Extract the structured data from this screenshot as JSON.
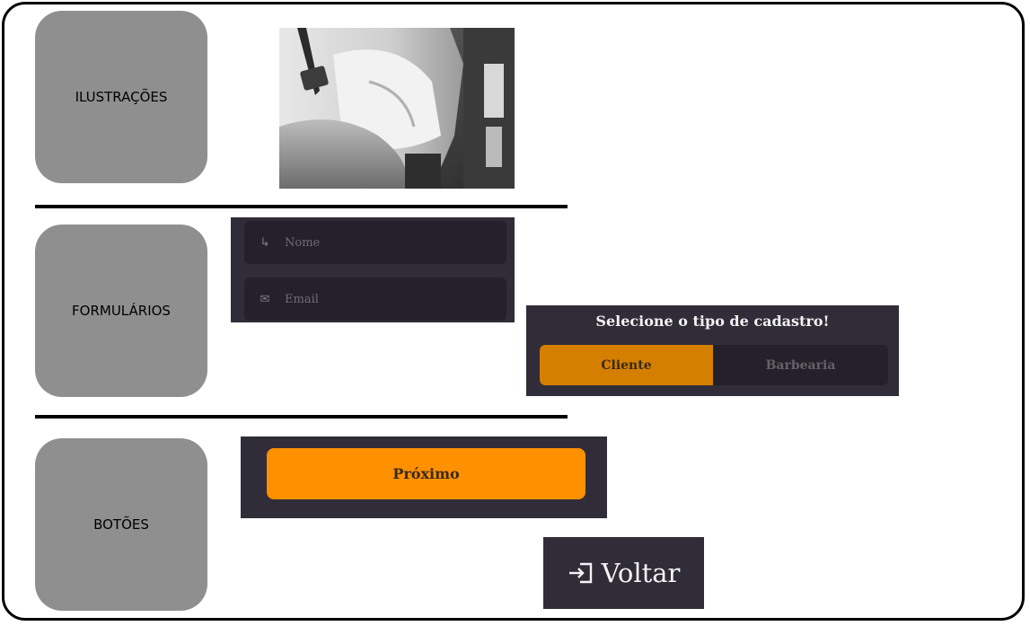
{
  "sections": {
    "illustrations": "ILUSTRAÇÕES",
    "forms": "FORMULÁRIOS",
    "buttons": "BOTÕES"
  },
  "form": {
    "name_placeholder": "Nome",
    "email_placeholder": "Email",
    "name_icon": "arrow-corner-icon",
    "email_icon": "envelope-icon"
  },
  "signup_type": {
    "title": "Selecione o tipo de cadastro!",
    "options": [
      "Cliente",
      "Barbearia"
    ],
    "selected": "Cliente"
  },
  "buttons": {
    "next_label": "Próximo",
    "back_label": "Voltar",
    "back_icon": "login-arrow-icon"
  },
  "colors": {
    "panel": "#312d38",
    "field": "#24212a",
    "accent": "#ff9000",
    "selected_option": "#d47f00",
    "label_box": "#8f8f8f"
  }
}
